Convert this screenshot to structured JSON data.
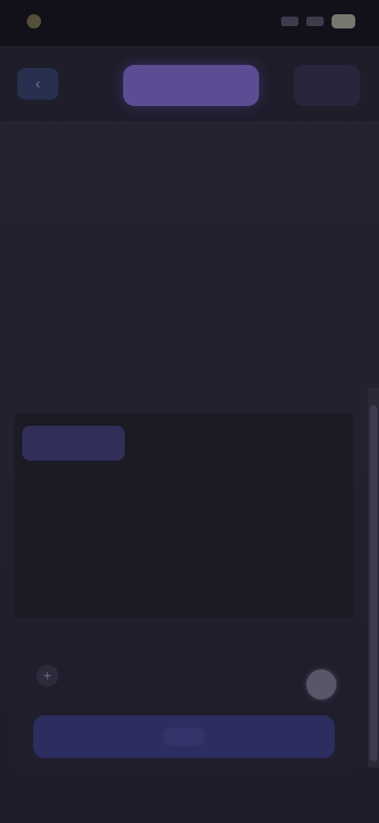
{
  "status": {
    "time": "",
    "signal_icon": "signal-icon",
    "wifi_icon": "wifi-icon",
    "battery_icon": "battery-icon"
  },
  "tabs": {
    "left": "‹",
    "center": "",
    "right": ""
  },
  "content": {
    "heading_1": "",
    "sub_1": "",
    "row_1": "",
    "row_2": "",
    "heading_2": "",
    "row_3": "",
    "heading_3": "",
    "row_4": "",
    "selected_chip": "",
    "option_1": "",
    "option_2": "",
    "link_row": ""
  },
  "composer": {
    "plus_icon": "+",
    "title": "",
    "placeholder": "",
    "send_label": ""
  },
  "colors": {
    "accent": "#5b4c93",
    "background": "#22212e",
    "panel": "#1b1a25",
    "link": "#4f5fa3"
  }
}
